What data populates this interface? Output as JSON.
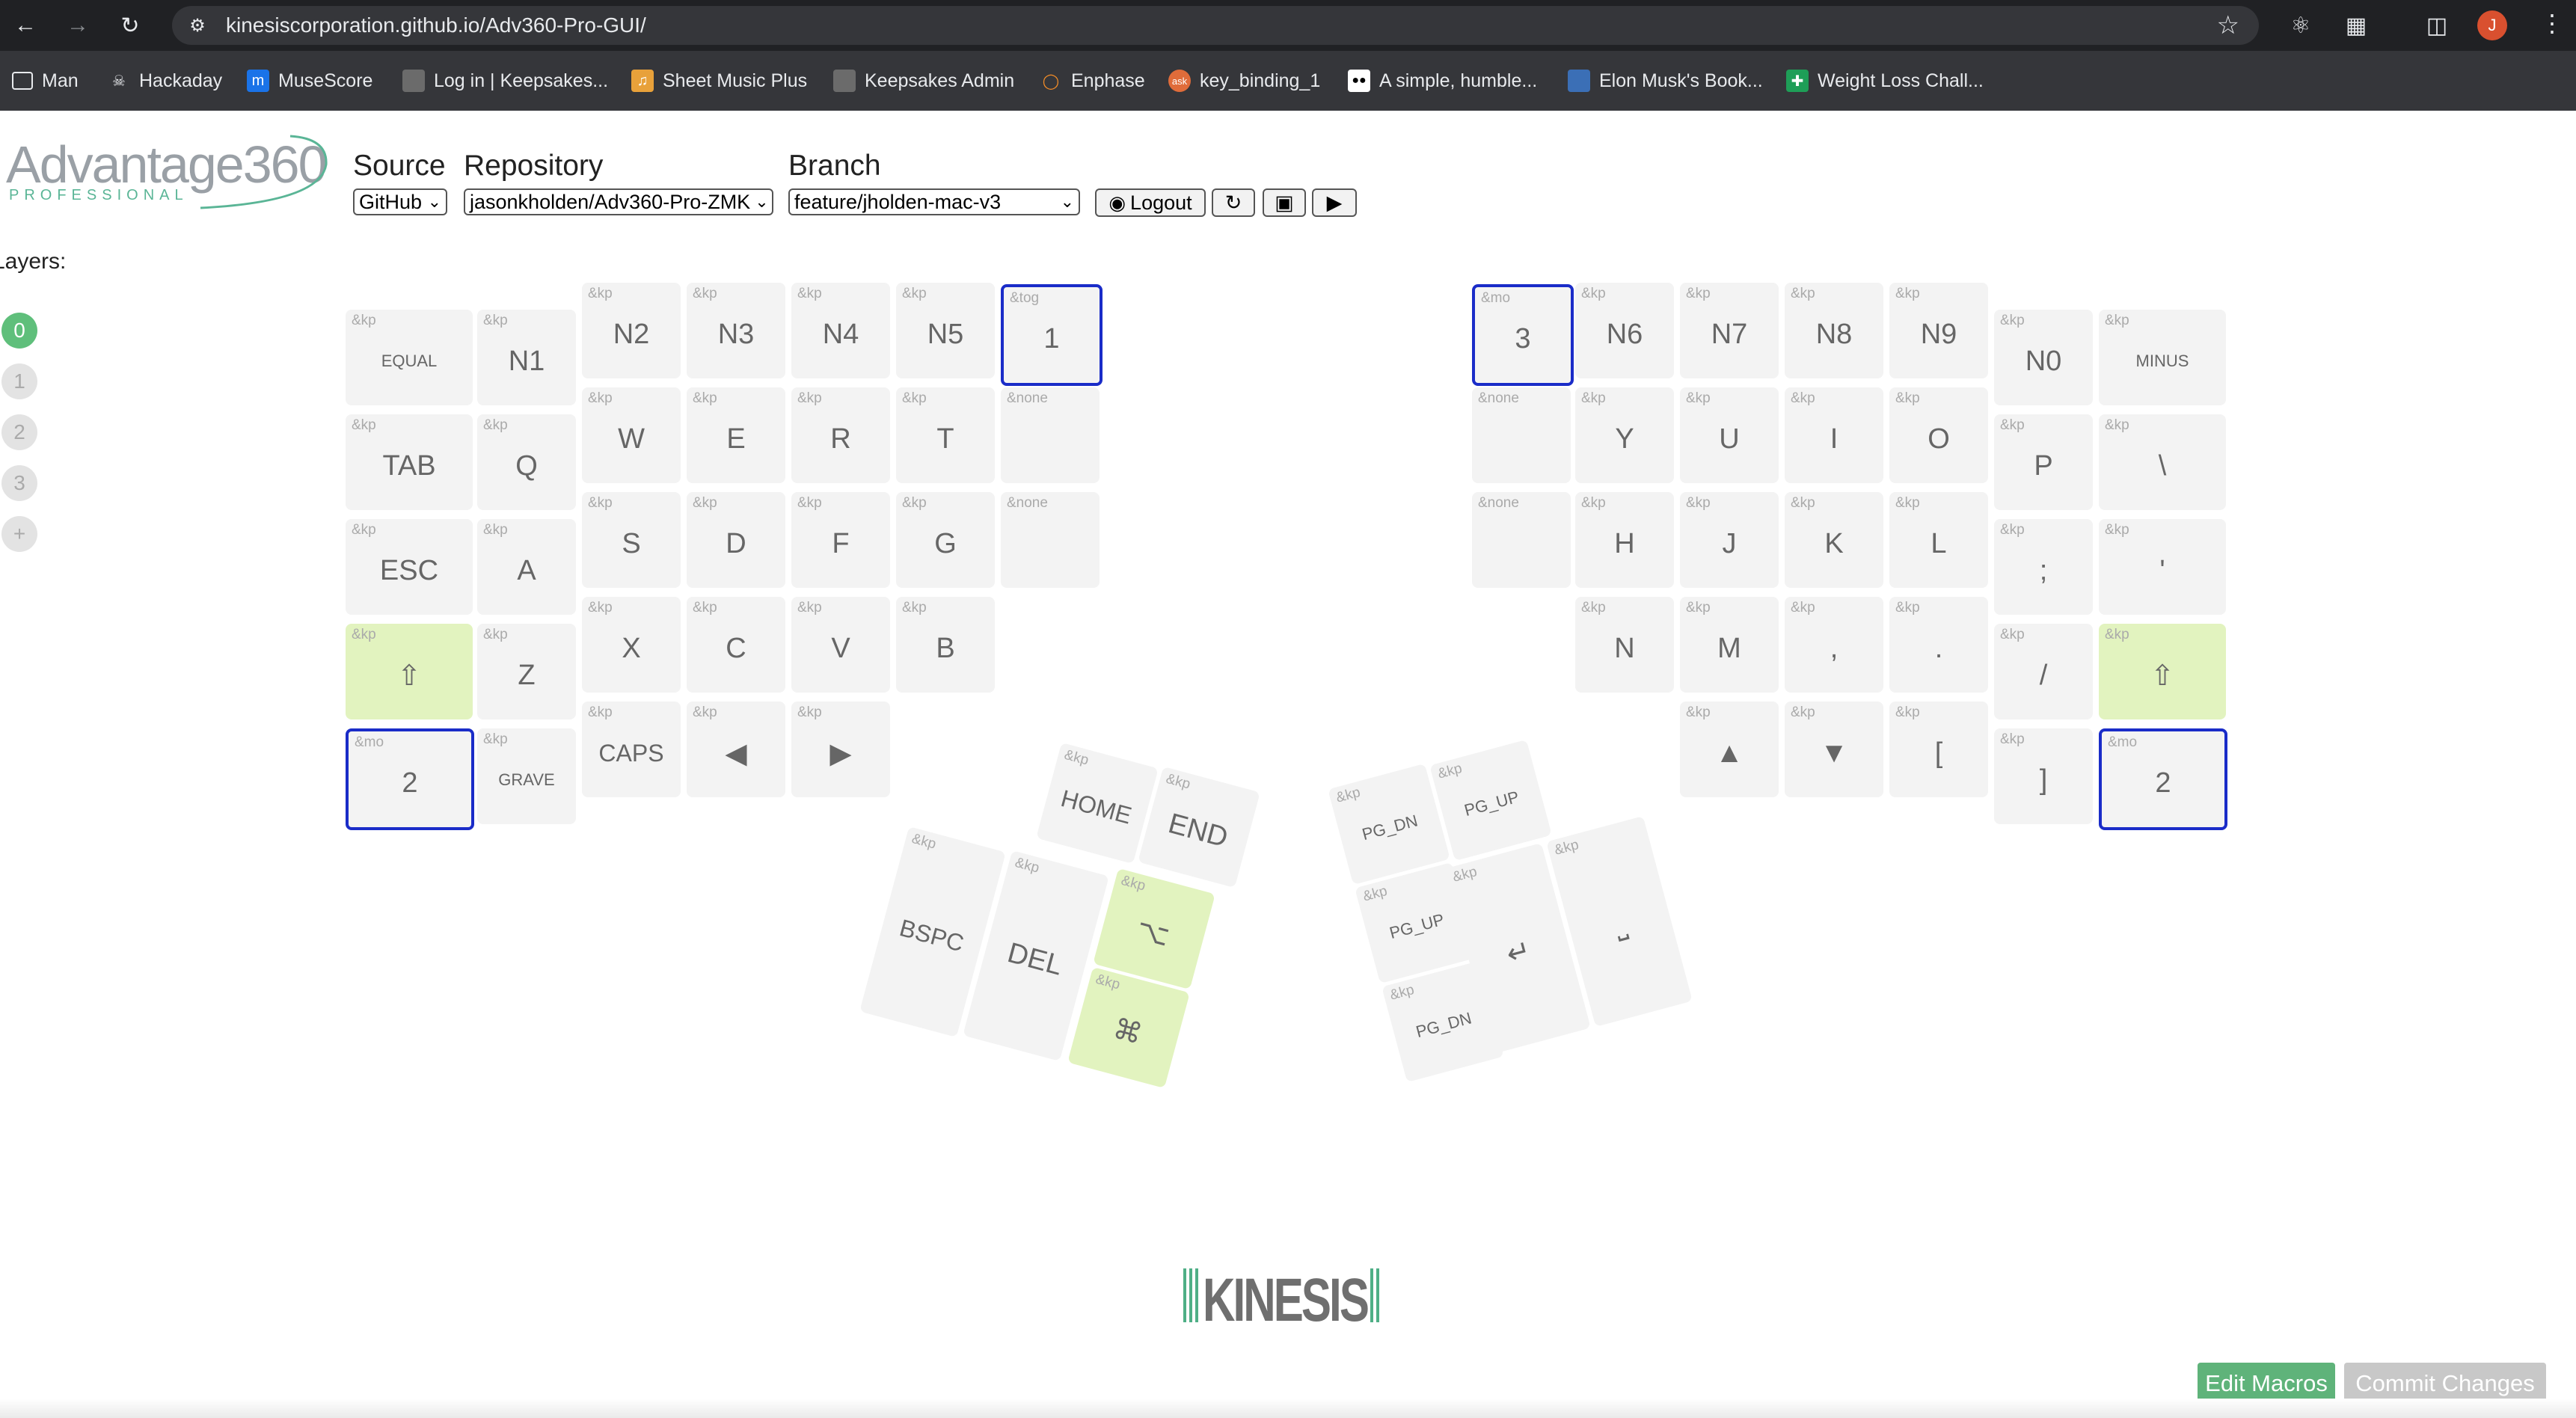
{
  "browser": {
    "url": "kinesiscorporation.github.io/Adv360-Pro-GUI/",
    "avatar_letter": "J",
    "bookmarks": [
      {
        "label": "Man",
        "icon": "folder-icon"
      },
      {
        "label": "Hackaday",
        "icon": "hackaday-icon"
      },
      {
        "label": "MuseScore",
        "icon": "musescore-icon"
      },
      {
        "label": "Log in | Keepsakes...",
        "icon": "keepsakes-icon"
      },
      {
        "label": "Sheet Music Plus",
        "icon": "sheetmusicplus-icon"
      },
      {
        "label": "Keepsakes Admin",
        "icon": "keepsakes-admin-icon"
      },
      {
        "label": "Enphase",
        "icon": "enphase-icon"
      },
      {
        "label": "key_binding_1",
        "icon": "key-binding-icon"
      },
      {
        "label": "A simple, humble...",
        "icon": "medium-icon"
      },
      {
        "label": "Elon Musk's Book...",
        "icon": "book-icon"
      },
      {
        "label": "Weight Loss Chall...",
        "icon": "sheets-icon"
      }
    ]
  },
  "app": {
    "logo_main": "Advantage360",
    "logo_sub": "PROFESSIONAL",
    "source_label": "Source",
    "repository_label": "Repository",
    "branch_label": "Branch",
    "source_value": "GitHub",
    "repository_value": "jasonkholden/Adv360-Pro-ZMK",
    "branch_value": "feature/jholden-mac-v3",
    "logout_label": "Logout",
    "layers_label": "Layers:",
    "layers": [
      "0",
      "1",
      "2",
      "3",
      "+"
    ],
    "brand": "KINESIS",
    "edit_macros": "Edit Macros",
    "commit_changes": "Commit Changes",
    "colors": {
      "highlight": "#e2f3bf",
      "selected_border": "#1a2cc8",
      "layer_active": "#5fbf7b",
      "edit_macros_bg": "#5fb37a",
      "commit_bg": "#c8c8c8"
    }
  },
  "keys": [
    {
      "b": "&kp",
      "l": "EQUAL"
    },
    {
      "b": "&kp",
      "l": "N1"
    },
    {
      "b": "&kp",
      "l": "N2"
    },
    {
      "b": "&kp",
      "l": "N3"
    },
    {
      "b": "&kp",
      "l": "N4"
    },
    {
      "b": "&kp",
      "l": "N5"
    },
    {
      "b": "&tog",
      "l": "1"
    },
    {
      "b": "&mo",
      "l": "3"
    },
    {
      "b": "&kp",
      "l": "N6"
    },
    {
      "b": "&kp",
      "l": "N7"
    },
    {
      "b": "&kp",
      "l": "N8"
    },
    {
      "b": "&kp",
      "l": "N9"
    },
    {
      "b": "&kp",
      "l": "N0"
    },
    {
      "b": "&kp",
      "l": "MINUS"
    },
    {
      "b": "&kp",
      "l": "TAB"
    },
    {
      "b": "&kp",
      "l": "Q"
    },
    {
      "b": "&kp",
      "l": "W"
    },
    {
      "b": "&kp",
      "l": "E"
    },
    {
      "b": "&kp",
      "l": "R"
    },
    {
      "b": "&kp",
      "l": "T"
    },
    {
      "b": "&none",
      "l": ""
    },
    {
      "b": "&none",
      "l": ""
    },
    {
      "b": "&kp",
      "l": "Y"
    },
    {
      "b": "&kp",
      "l": "U"
    },
    {
      "b": "&kp",
      "l": "I"
    },
    {
      "b": "&kp",
      "l": "O"
    },
    {
      "b": "&kp",
      "l": "P"
    },
    {
      "b": "&kp",
      "l": "\\"
    },
    {
      "b": "&kp",
      "l": "ESC"
    },
    {
      "b": "&kp",
      "l": "A"
    },
    {
      "b": "&kp",
      "l": "S"
    },
    {
      "b": "&kp",
      "l": "D"
    },
    {
      "b": "&kp",
      "l": "F"
    },
    {
      "b": "&kp",
      "l": "G"
    },
    {
      "b": "&none",
      "l": ""
    },
    {
      "b": "&none",
      "l": ""
    },
    {
      "b": "&kp",
      "l": "H"
    },
    {
      "b": "&kp",
      "l": "J"
    },
    {
      "b": "&kp",
      "l": "K"
    },
    {
      "b": "&kp",
      "l": "L"
    },
    {
      "b": "&kp",
      "l": ";"
    },
    {
      "b": "&kp",
      "l": "'"
    },
    {
      "b": "&kp",
      "l": "⇧"
    },
    {
      "b": "&kp",
      "l": "Z"
    },
    {
      "b": "&kp",
      "l": "X"
    },
    {
      "b": "&kp",
      "l": "C"
    },
    {
      "b": "&kp",
      "l": "V"
    },
    {
      "b": "&kp",
      "l": "B"
    },
    {
      "b": "&kp",
      "l": "N"
    },
    {
      "b": "&kp",
      "l": "M"
    },
    {
      "b": "&kp",
      "l": ","
    },
    {
      "b": "&kp",
      "l": "."
    },
    {
      "b": "&kp",
      "l": "/"
    },
    {
      "b": "&kp",
      "l": "⇧"
    },
    {
      "b": "&mo",
      "l": "2"
    },
    {
      "b": "&kp",
      "l": "GRAVE"
    },
    {
      "b": "&kp",
      "l": "CAPS"
    },
    {
      "b": "&kp",
      "l": "◀"
    },
    {
      "b": "&kp",
      "l": "▶"
    },
    {
      "b": "&kp",
      "l": "▲"
    },
    {
      "b": "&kp",
      "l": "▼"
    },
    {
      "b": "&kp",
      "l": "["
    },
    {
      "b": "&kp",
      "l": "]"
    },
    {
      "b": "&mo",
      "l": "2"
    },
    {
      "b": "&kp",
      "l": "HOME"
    },
    {
      "b": "&kp",
      "l": "END"
    },
    {
      "b": "&kp",
      "l": "BSPC"
    },
    {
      "b": "&kp",
      "l": "DEL"
    },
    {
      "b": "&kp",
      "l": "⌥"
    },
    {
      "b": "&kp",
      "l": "⌘"
    },
    {
      "b": "&kp",
      "l": "PG_DN"
    },
    {
      "b": "&kp",
      "l": "PG_UP"
    },
    {
      "b": "&kp",
      "l": "PG_UP"
    },
    {
      "b": "&kp",
      "l": "PG_DN"
    },
    {
      "b": "&kp",
      "l": "↵"
    },
    {
      "b": "&kp",
      "l": "⎵"
    }
  ]
}
